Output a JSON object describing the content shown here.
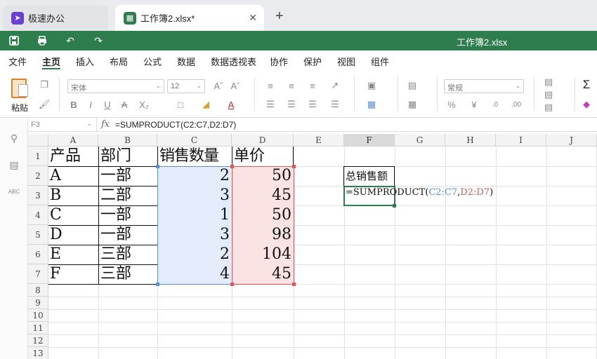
{
  "tabs": [
    {
      "label": "极速办公",
      "icon": "rocket-icon",
      "color": "#6b3fd4"
    },
    {
      "label": "工作簿2.xlsx*",
      "icon": "sheet-icon",
      "color": "#2e7d4f"
    }
  ],
  "title": "工作簿2.xlsx",
  "menu": [
    "文件",
    "主页",
    "插入",
    "布局",
    "公式",
    "数据",
    "数据透视表",
    "协作",
    "保护",
    "视图",
    "组件"
  ],
  "ribbon": {
    "paste_label": "粘贴",
    "font_name": "宋体",
    "font_size": "12",
    "number_format": "常规"
  },
  "formula_bar": {
    "cell_ref": "F3",
    "fx": "fx",
    "formula": "=SUMPRODUCT(C2:C7,D2:D7)"
  },
  "sheet": {
    "columns": [
      "A",
      "B",
      "C",
      "D",
      "E",
      "F",
      "G",
      "H",
      "I",
      "J"
    ],
    "selected_column": "F",
    "rows": [
      "1",
      "2",
      "3",
      "4",
      "5",
      "6",
      "7",
      "8",
      "9",
      "10",
      "11",
      "12",
      "13"
    ],
    "headers": [
      "产品",
      "部门",
      "销售数量",
      "单价"
    ],
    "data": [
      [
        "A",
        "一部",
        "2",
        "50"
      ],
      [
        "B",
        "二部",
        "3",
        "45"
      ],
      [
        "C",
        "一部",
        "1",
        "50"
      ],
      [
        "D",
        "一部",
        "3",
        "98"
      ],
      [
        "E",
        "三部",
        "2",
        "104"
      ],
      [
        "F",
        "三部",
        "4",
        "45"
      ]
    ],
    "f2_label": "总销售额",
    "f3_formula_prefix": "=SUMPRODUCT(",
    "f3_range1": "C2:C7",
    "f3_comma": ",",
    "f3_range2": "D2:D7",
    "f3_suffix": ")"
  },
  "colors": {
    "accent": "#2e7d4f",
    "range1": "#5b8fd6",
    "range2": "#d65b5b"
  }
}
